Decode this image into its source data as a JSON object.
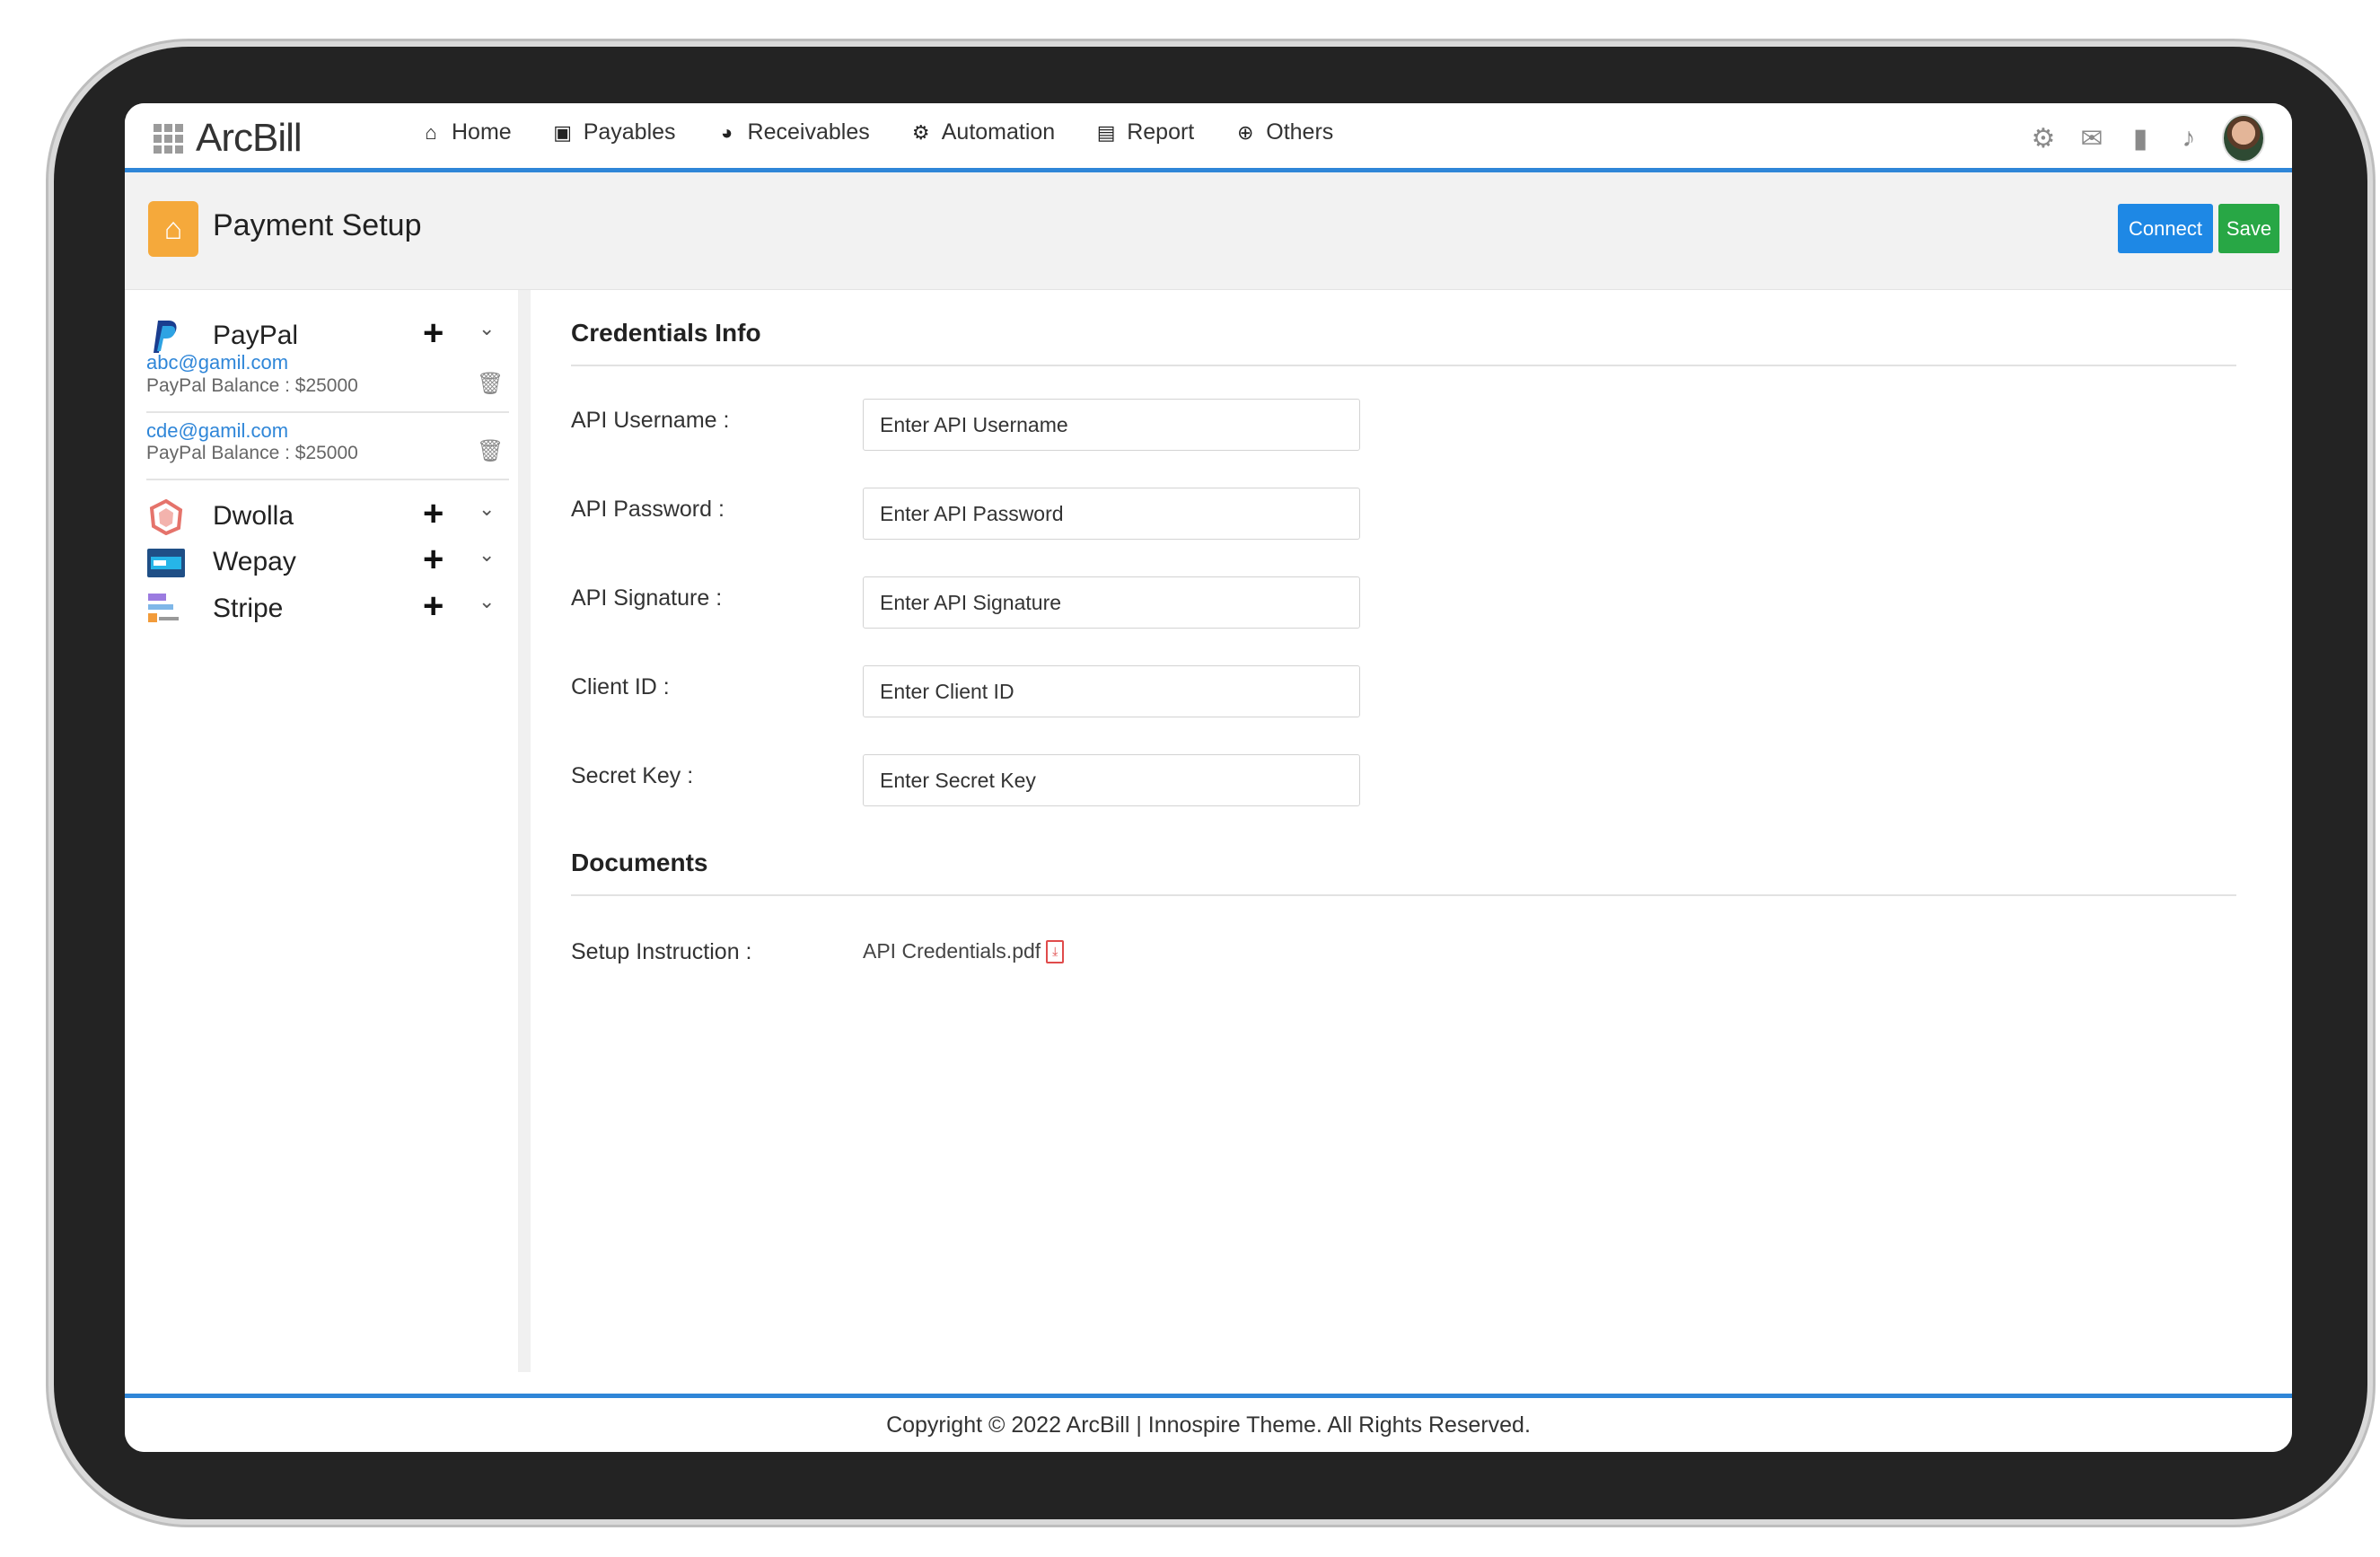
{
  "app": {
    "name": "ArcBill"
  },
  "nav": {
    "items": [
      {
        "label": "Home",
        "icon": "home-icon"
      },
      {
        "label": "Payables",
        "icon": "briefcase-icon"
      },
      {
        "label": "Receivables",
        "icon": "pie-chart-icon"
      },
      {
        "label": "Automation",
        "icon": "cogs-icon"
      },
      {
        "label": "Report",
        "icon": "file-icon"
      },
      {
        "label": "Others",
        "icon": "plus-circle-icon"
      }
    ],
    "right_icons": [
      "gear-icon",
      "mail-icon",
      "file-icon",
      "bell-icon",
      "avatar"
    ]
  },
  "header": {
    "title": "Payment Setup",
    "connect_label": "Connect",
    "save_label": "Save"
  },
  "sidebar": {
    "paypal": {
      "name": "PayPal",
      "accounts": [
        {
          "email": "abc@gamil.com",
          "balance": "PayPal Balance : $25000"
        },
        {
          "email": "cde@gamil.com",
          "balance": "PayPal Balance : $25000"
        }
      ]
    },
    "dwolla": {
      "name": "Dwolla"
    },
    "wepay": {
      "name": "Wepay"
    },
    "stripe": {
      "name": "Stripe"
    }
  },
  "credentials": {
    "title": "Credentials Info",
    "fields": [
      {
        "label": "API Username :",
        "placeholder": "Enter API Username"
      },
      {
        "label": "API Password :",
        "placeholder": "Enter API Password"
      },
      {
        "label": "API Signature :",
        "placeholder": "Enter API Signature"
      },
      {
        "label": "Client ID :",
        "placeholder": "Enter Client ID"
      },
      {
        "label": "Secret Key :",
        "placeholder": "Enter Secret Key"
      }
    ]
  },
  "documents": {
    "title": "Documents",
    "setup_label": "Setup Instruction :",
    "file_name": "API Credentials.pdf"
  },
  "footer": {
    "text": "Copyright © 2022 ArcBill | Innospire Theme. All Rights Reserved."
  },
  "colors": {
    "accent": "#2f86d8",
    "connect": "#1e88e5",
    "save": "#28a745",
    "home_badge": "#f5a93b"
  }
}
